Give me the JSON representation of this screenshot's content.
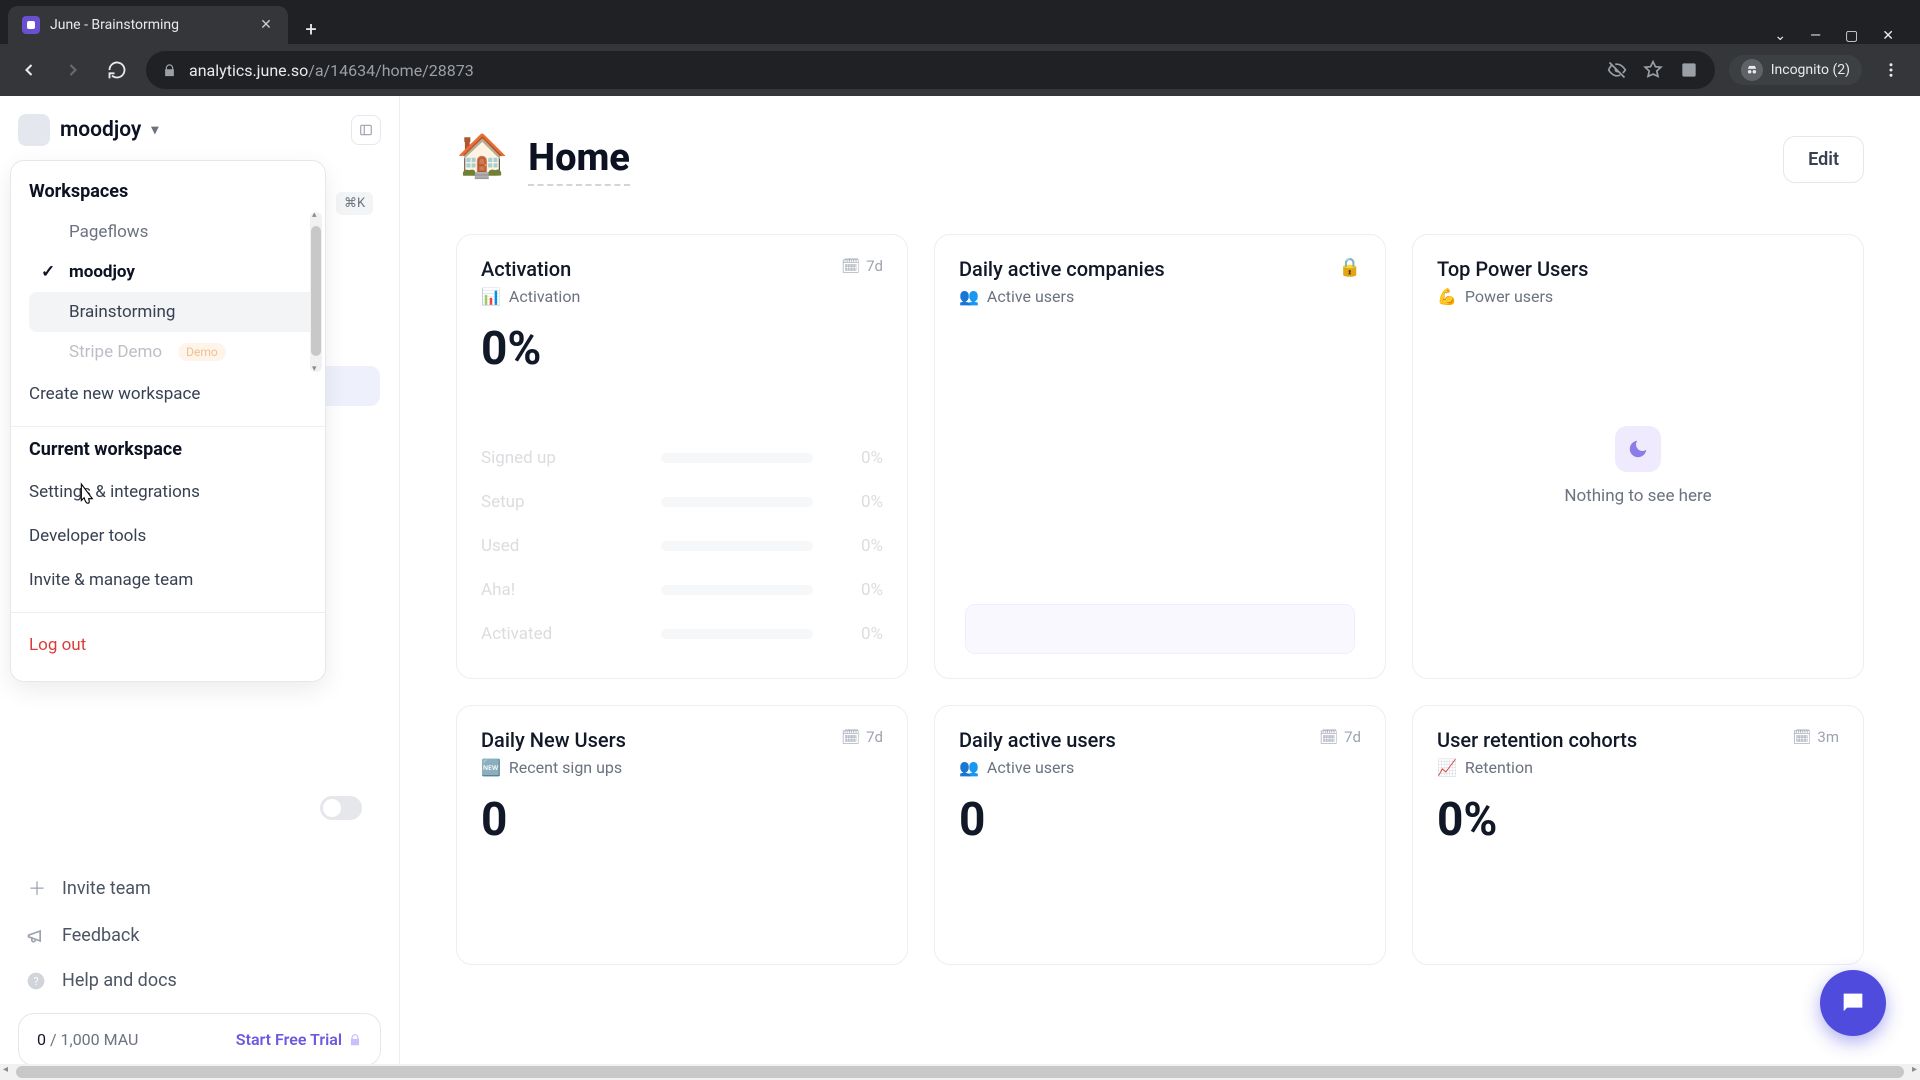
{
  "browser": {
    "tab_title": "June - Brainstorming",
    "url_host": "analytics.june.so",
    "url_path": "/a/14634/home/28873",
    "incognito_label": "Incognito (2)"
  },
  "workspace_selector": {
    "current": "moodjoy"
  },
  "dropdown": {
    "workspaces_header": "Workspaces",
    "items": [
      {
        "label": "Pageflows",
        "selected": false
      },
      {
        "label": "moodjoy",
        "selected": true
      },
      {
        "label": "Brainstorming",
        "selected": false,
        "hovered": true
      },
      {
        "label": "Stripe Demo",
        "selected": false,
        "badge": "Demo",
        "partial": true
      }
    ],
    "create_label": "Create new workspace",
    "current_header": "Current workspace",
    "settings_label": "Settings & integrations",
    "dev_label": "Developer tools",
    "invite_label": "Invite & manage team",
    "logout_label": "Log out"
  },
  "behind": {
    "kbd": "⌘K"
  },
  "sidebar_bottom": {
    "invite": "Invite team",
    "feedback": "Feedback",
    "help": "Help and docs"
  },
  "mau": {
    "count": "0",
    "sep": " / ",
    "limit": "1,000 MAU",
    "cta": "Start Free Trial"
  },
  "page": {
    "emoji": "🏠",
    "title": "Home",
    "edit": "Edit"
  },
  "cards": {
    "activation": {
      "title": "Activation",
      "period": "7d",
      "sub_icon": "📊",
      "sub": "Activation",
      "stat": "0%",
      "rows": [
        {
          "label": "Signed up",
          "val": "0%"
        },
        {
          "label": "Setup",
          "val": "0%"
        },
        {
          "label": "Used",
          "val": "0%"
        },
        {
          "label": "Aha!",
          "val": "0%"
        },
        {
          "label": "Activated",
          "val": "0%"
        }
      ]
    },
    "dac": {
      "title": "Daily active companies",
      "sub_icon": "👥",
      "sub": "Active users"
    },
    "power": {
      "title": "Top Power Users",
      "sub_icon": "💪",
      "sub": "Power users",
      "empty": "Nothing to see here"
    },
    "dnu": {
      "title": "Daily New Users",
      "period": "7d",
      "sub_icon": "🆕",
      "sub": "Recent sign ups",
      "stat": "0"
    },
    "dau": {
      "title": "Daily active users",
      "period": "7d",
      "sub_icon": "👥",
      "sub": "Active users",
      "stat": "0"
    },
    "retention": {
      "title": "User retention cohorts",
      "period": "3m",
      "sub_icon": "📈",
      "sub": "Retention",
      "stat": "0%"
    }
  }
}
